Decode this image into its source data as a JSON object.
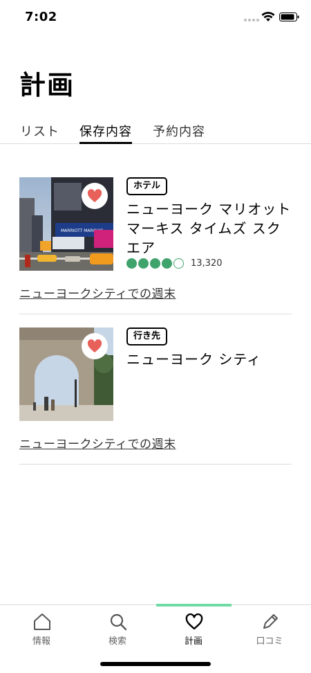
{
  "status_bar": {
    "time": "7:02"
  },
  "header": {
    "title": "計画"
  },
  "tabs": [
    {
      "label": "リスト",
      "active": false
    },
    {
      "label": "保存内容",
      "active": true
    },
    {
      "label": "予約内容",
      "active": false
    }
  ],
  "cards": [
    {
      "badge": "ホテル",
      "title": "ニューヨーク マリオット マーキス タイムズ スクエア",
      "rating": 4,
      "rating_max": 5,
      "review_count": "13,320",
      "trip_link": "ニューヨークシティでの週末",
      "saved": true
    },
    {
      "badge": "行き先",
      "title": "ニューヨーク シティ",
      "trip_link": "ニューヨークシティでの週末",
      "saved": true
    }
  ],
  "bottom_nav": [
    {
      "label": "情報",
      "icon": "home-icon",
      "active": false
    },
    {
      "label": "検索",
      "icon": "search-icon",
      "active": false
    },
    {
      "label": "計画",
      "icon": "heart-icon",
      "active": true
    },
    {
      "label": "口コミ",
      "icon": "pencil-icon",
      "active": false
    }
  ],
  "colors": {
    "rating_green": "#3fa36c",
    "heart_red": "#e8605a",
    "nav_indicator": "#6fdaa5"
  }
}
